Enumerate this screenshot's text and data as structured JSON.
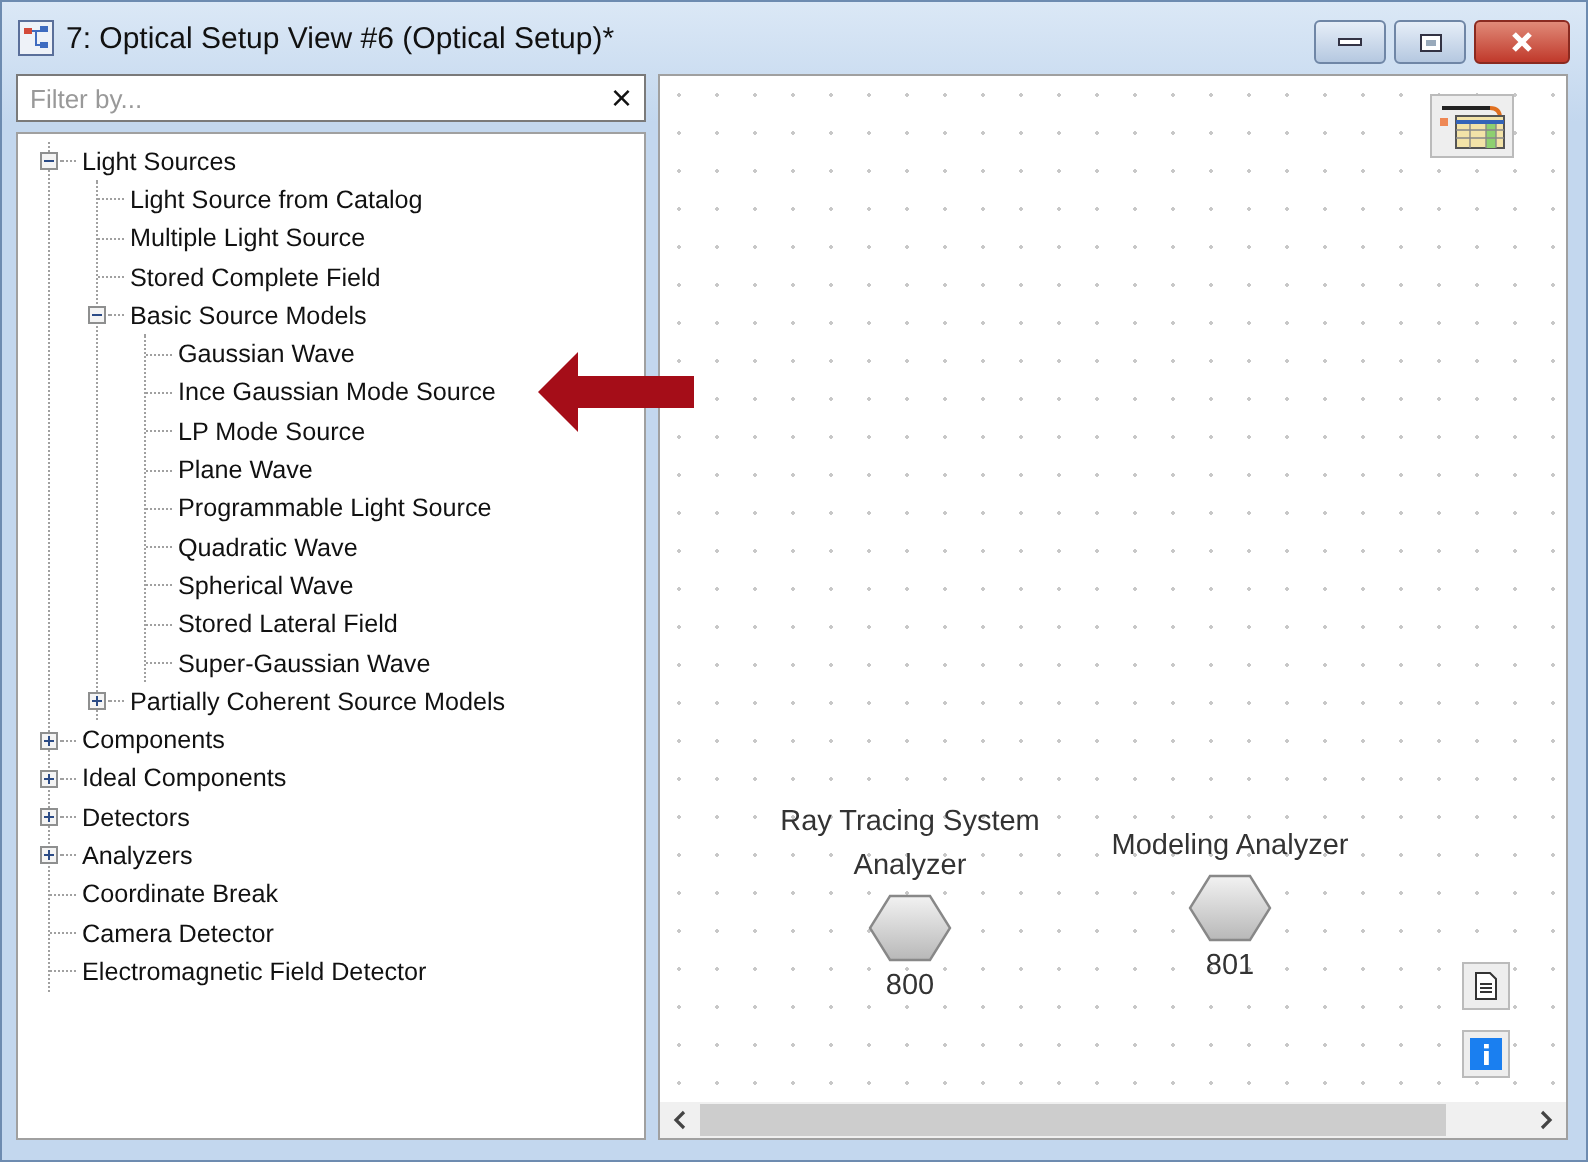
{
  "window": {
    "title": "7: Optical Setup View #6 (Optical Setup)*"
  },
  "filter": {
    "placeholder": "Filter by...",
    "clear": "×"
  },
  "tree": [
    {
      "label": "Light Sources",
      "expanded": true,
      "children": [
        {
          "label": "Light Source from Catalog"
        },
        {
          "label": "Multiple Light Source"
        },
        {
          "label": "Stored Complete Field"
        },
        {
          "label": "Basic Source Models",
          "expanded": true,
          "children": [
            {
              "label": "Gaussian Wave"
            },
            {
              "label": "Ince Gaussian Mode Source"
            },
            {
              "label": "LP Mode Source"
            },
            {
              "label": "Plane Wave"
            },
            {
              "label": "Programmable Light Source"
            },
            {
              "label": "Quadratic Wave"
            },
            {
              "label": "Spherical Wave"
            },
            {
              "label": "Stored Lateral Field"
            },
            {
              "label": "Super-Gaussian Wave"
            }
          ]
        },
        {
          "label": "Partially Coherent Source Models",
          "expanded": false
        }
      ]
    },
    {
      "label": "Components",
      "expanded": false
    },
    {
      "label": "Ideal Components",
      "expanded": false
    },
    {
      "label": "Detectors",
      "expanded": false
    },
    {
      "label": "Analyzers",
      "expanded": false
    },
    {
      "label": "Coordinate Break"
    },
    {
      "label": "Camera Detector"
    },
    {
      "label": "Electromagnetic Field Detector"
    }
  ],
  "canvas": {
    "nodes": [
      {
        "label": "Ray Tracing System Analyzer",
        "number": "800"
      },
      {
        "label": "Modeling Analyzer",
        "number": "801"
      }
    ]
  }
}
